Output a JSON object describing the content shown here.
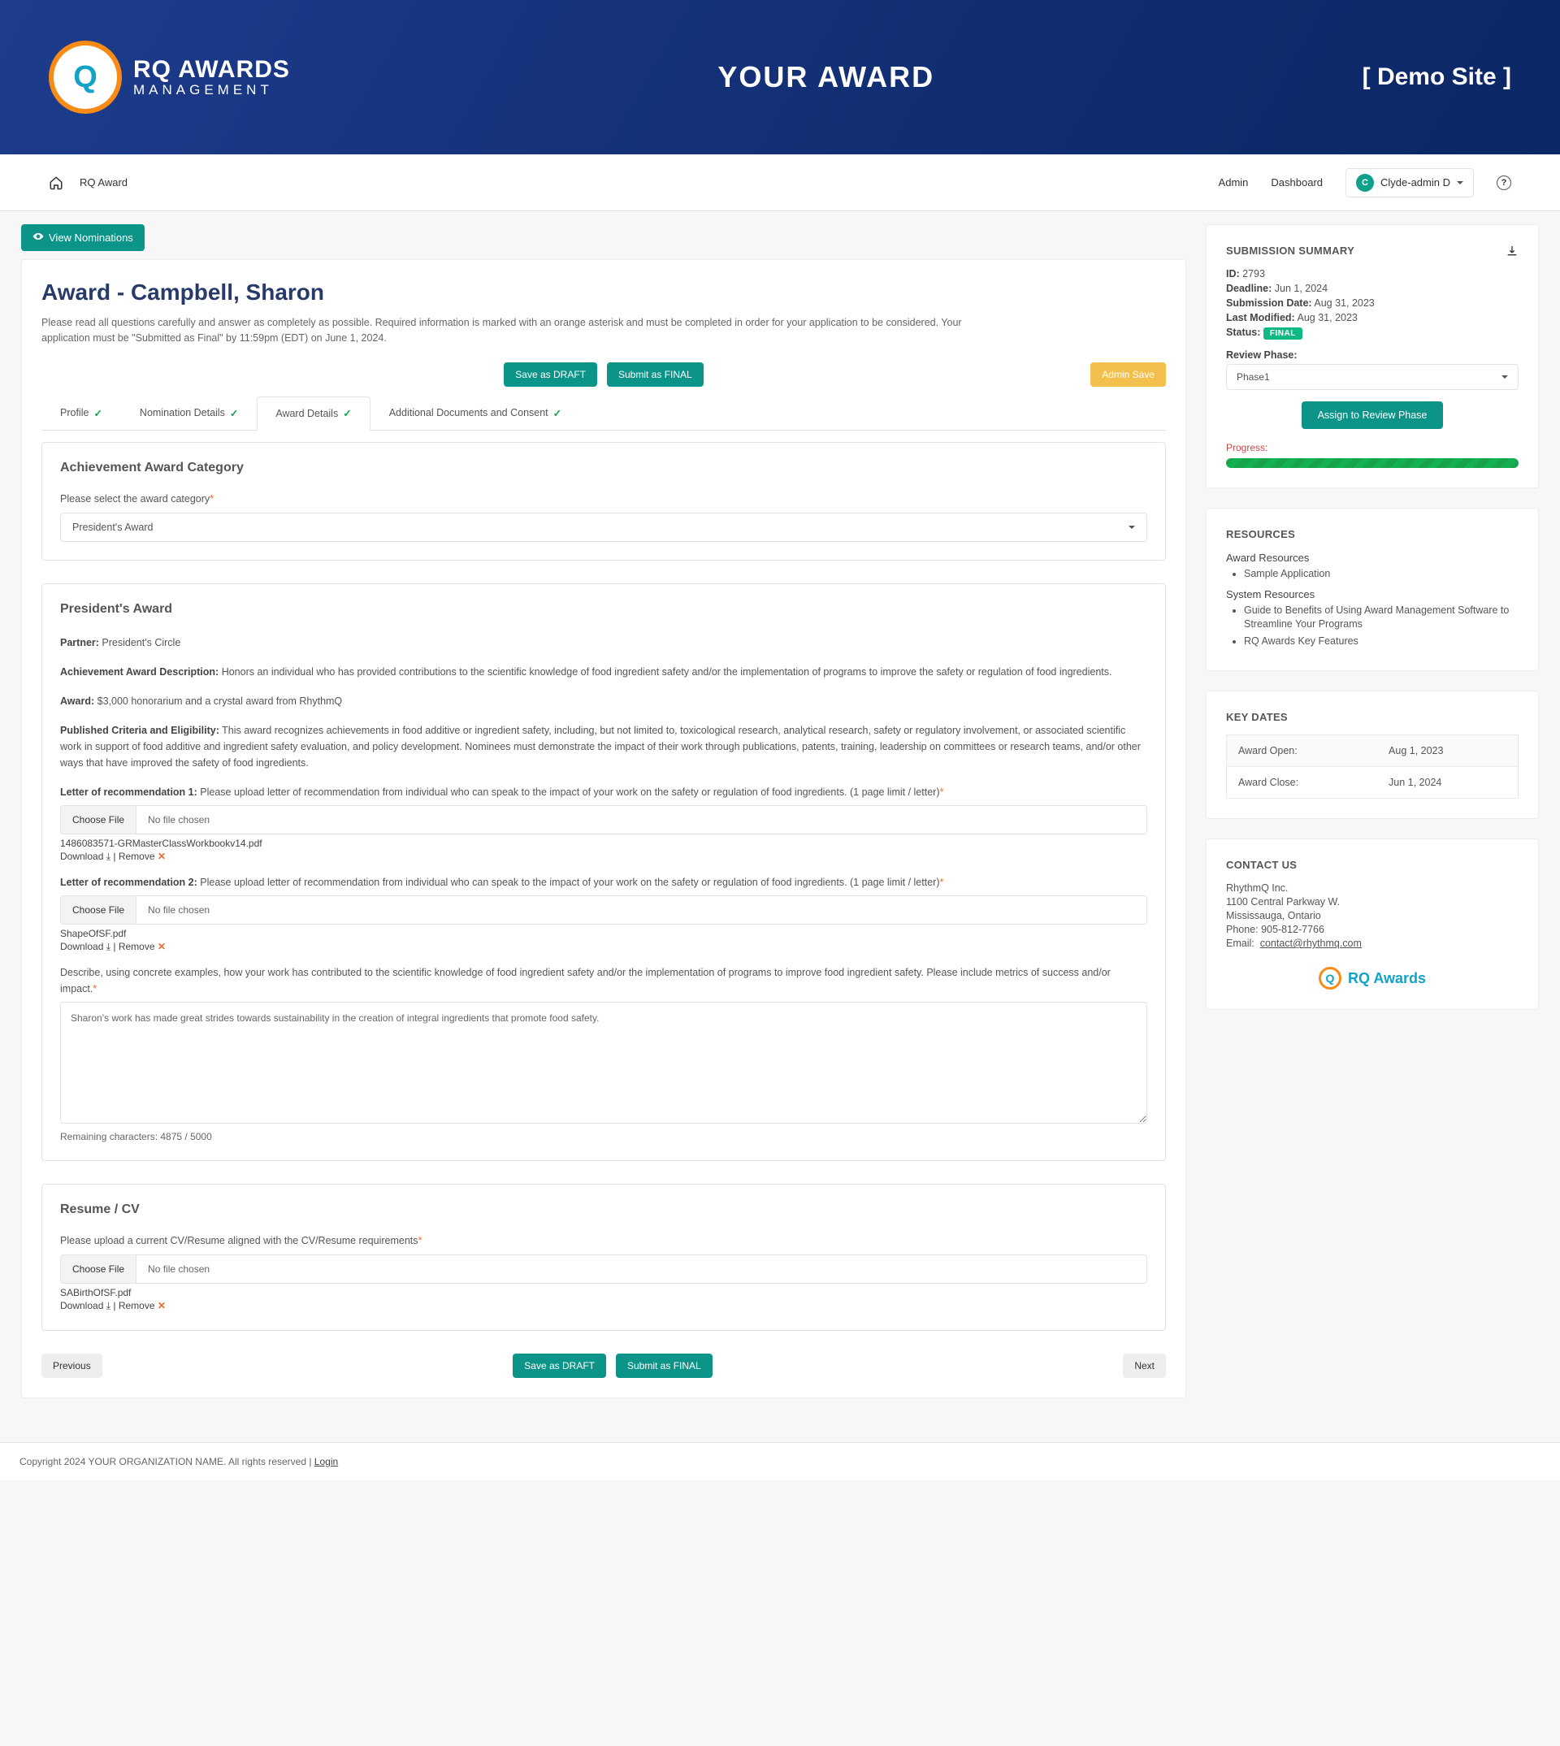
{
  "banner": {
    "logo_l1": "RQ AWARDS",
    "logo_l2": "MANAGEMENT",
    "center": "YOUR  AWARD",
    "right": "[ Demo Site ]"
  },
  "topbar": {
    "home_label": "RQ Award",
    "links": {
      "admin": "Admin",
      "dashboard": "Dashboard"
    },
    "user": {
      "initial": "C",
      "name": "Clyde-admin D"
    }
  },
  "view_nominations": "View Nominations",
  "title": "Award - Campbell, Sharon",
  "description": "Please read all questions carefully and answer as completely as possible. Required information is marked with an orange asterisk and must be completed in order for your application to be considered. Your application must be \"Submitted as Final\" by 11:59pm (EDT) on June 1, 2024.",
  "buttons": {
    "save_draft": "Save as DRAFT",
    "submit_final": "Submit as FINAL",
    "admin_save": "Admin Save",
    "previous": "Previous",
    "next": "Next"
  },
  "tabs": [
    {
      "label": "Profile",
      "complete": true,
      "active": false
    },
    {
      "label": "Nomination Details",
      "complete": true,
      "active": false
    },
    {
      "label": "Award Details",
      "complete": true,
      "active": true
    },
    {
      "label": "Additional Documents and Consent",
      "complete": true,
      "active": false
    }
  ],
  "section_category": {
    "heading": "Achievement Award Category",
    "label": "Please select the award category",
    "value": "President's Award"
  },
  "section_award": {
    "heading": "President's Award",
    "partner_label": "Partner:",
    "partner_value": "President's Circle",
    "desc_label": "Achievement Award Description:",
    "desc_value": "Honors an individual who has provided contributions to the scientific knowledge of food ingredient safety and/or the implementation of programs to improve the safety or regulation of food ingredients.",
    "award_label": "Award:",
    "award_value": "$3,000 honorarium and a crystal award from RhythmQ",
    "criteria_label": "Published Criteria and Eligibility:",
    "criteria_value": "This award recognizes achievements in food additive or ingredient safety, including, but not limited to, toxicological research, analytical research, safety or regulatory involvement, or associated scientific work in support of food additive and ingredient safety evaluation, and policy development. Nominees must demonstrate the impact of their work through publications, patents, training, leadership on committees or research teams, and/or other ways that have improved the safety of food ingredients.",
    "rec1_label": "Letter of recommendation 1:",
    "rec1_text": "Please upload letter of recommendation from individual who can speak to the impact of your work on the safety or regulation of food ingredients. (1 page limit / letter)",
    "rec2_label": "Letter of recommendation 2:",
    "rec2_text": "Please upload letter of recommendation from individual who can speak to the impact of your work on the safety or regulation of food ingredients. (1 page limit / letter)",
    "choose_file": "Choose File",
    "no_file": "No file chosen",
    "file1": "1486083571-GRMasterClassWorkbookv14.pdf",
    "file2": "ShapeOfSF.pdf",
    "download": "Download",
    "remove": "Remove",
    "describe_label": "Describe, using concrete examples, how your work has contributed to the scientific knowledge of food ingredient safety and/or the implementation of programs to improve food ingredient safety. Please include metrics of success and/or impact.",
    "describe_value": "Sharon's work has made great strides towards sustainability in the creation of integral ingredients that promote food safety.",
    "remaining": "Remaining characters: 4875 / 5000"
  },
  "section_resume": {
    "heading": "Resume / CV",
    "label": "Please upload a current CV/Resume aligned with the CV/Resume requirements",
    "file": "SABirthOfSF.pdf"
  },
  "summary": {
    "heading": "SUBMISSION SUMMARY",
    "id_label": "ID:",
    "id_value": "2793",
    "deadline_label": "Deadline:",
    "deadline_value": "Jun 1, 2024",
    "subdate_label": "Submission Date:",
    "subdate_value": "Aug 31, 2023",
    "modified_label": "Last Modified:",
    "modified_value": "Aug 31, 2023",
    "status_label": "Status:",
    "status_value": "FINAL",
    "review_phase_label": "Review Phase:",
    "review_phase_value": "Phase1",
    "assign": "Assign to Review Phase",
    "progress_label": "Progress:"
  },
  "resources": {
    "heading": "RESOURCES",
    "award_sub": "Award Resources",
    "award_items": [
      "Sample Application"
    ],
    "system_sub": "System Resources",
    "system_items": [
      "Guide to Benefits of Using Award Management Software to Streamline Your Programs",
      "RQ Awards Key Features"
    ]
  },
  "keydates": {
    "heading": "KEY DATES",
    "rows": [
      {
        "label": "Award Open:",
        "value": "Aug 1, 2023"
      },
      {
        "label": "Award Close:",
        "value": "Jun 1, 2024"
      }
    ]
  },
  "contact": {
    "heading": "CONTACT US",
    "lines": [
      "RhythmQ Inc.",
      "1100 Central Parkway W.",
      "Mississauga, Ontario",
      "Phone: 905-812-7766"
    ],
    "email_label": "Email:",
    "email_value": "contact@rhythmq.com",
    "logo_text": "RQ Awards"
  },
  "footer": {
    "text": "Copyright  2024 YOUR ORGANIZATION NAME.  All rights reserved | ",
    "login": "Login"
  }
}
